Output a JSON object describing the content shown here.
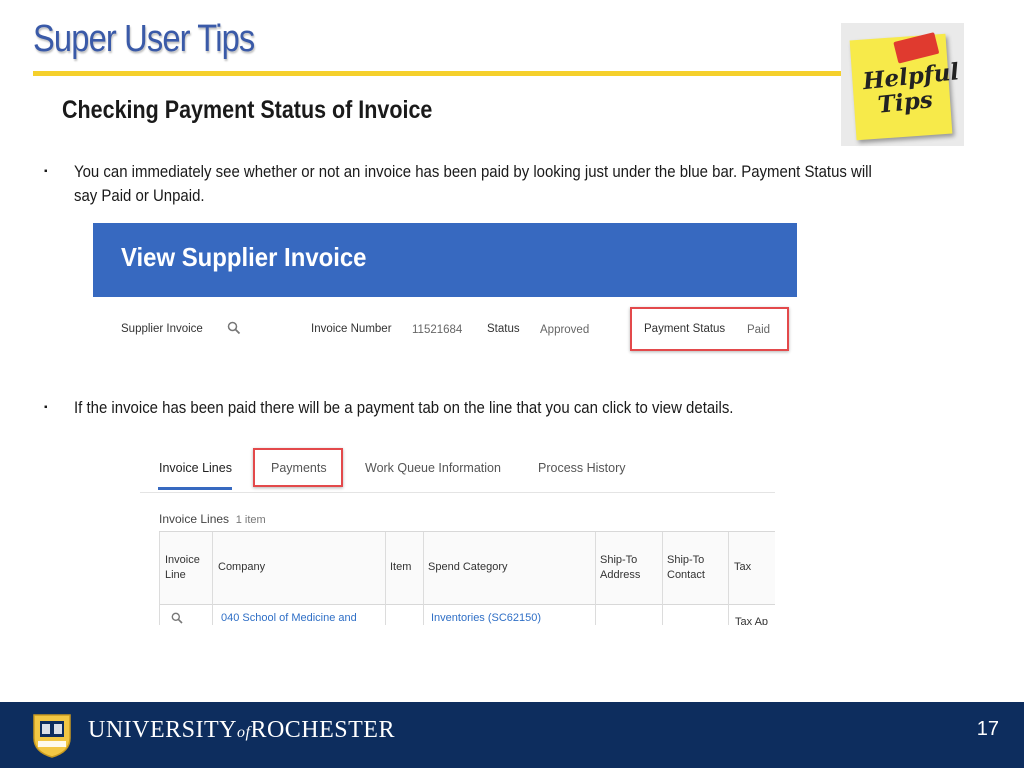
{
  "slide": {
    "title": "Super User Tips",
    "subtitle": "Checking Payment Status of Invoice",
    "bullet_1": "You can immediately see whether or not an invoice has been paid by looking just under the blue bar.  Payment Status will",
    "bullet_1_line2": "say Paid or Unpaid.",
    "bullet_2": "If the invoice has been paid there will be a payment tab on the line that you can click to view details.",
    "bullet_marker": "▪",
    "sticky_note": {
      "line1": "Helpful",
      "line2": "Tips"
    }
  },
  "invoice_header": {
    "title": "View Supplier Invoice",
    "supplier_invoice_label": "Supplier Invoice",
    "invoice_number_label": "Invoice Number",
    "invoice_number_value": "11521684",
    "status_label": "Status",
    "status_value": "Approved",
    "payment_status_label": "Payment Status",
    "payment_status_value": "Paid"
  },
  "invoice_tabs": {
    "tabs": [
      {
        "label": "Invoice Lines",
        "active": true
      },
      {
        "label": "Payments",
        "active": false
      },
      {
        "label": "Work Queue Information",
        "active": false
      },
      {
        "label": "Process History",
        "active": false
      }
    ]
  },
  "invoice_lines": {
    "title": "Invoice Lines",
    "count": "1 item",
    "columns": [
      {
        "line1": "Invoice",
        "line2": "Line"
      },
      {
        "line1": "Company",
        "line2": ""
      },
      {
        "line1": "Item",
        "line2": ""
      },
      {
        "line1": "Spend Category",
        "line2": ""
      },
      {
        "line1": "Ship-To",
        "line2": "Address"
      },
      {
        "line1": "Ship-To",
        "line2": "Contact"
      },
      {
        "line1": "Tax",
        "line2": ""
      }
    ],
    "row": {
      "company": "040 School of Medicine and",
      "spend_category": "Inventories (SC62150)",
      "tax": "Tax Ap"
    }
  },
  "footer": {
    "university_part1": "UNIVERSITY",
    "university_of": "of",
    "university_part2": "ROCHESTER",
    "page_number": "17"
  },
  "colors": {
    "title_blue": "#3a5aa8",
    "rule_yellow": "#f5d02c",
    "bar_blue": "#3769c0",
    "highlight_red": "#e3494b",
    "footer_navy": "#0d2d5e"
  },
  "icons": [
    "search-icon",
    "sticky-note-icon",
    "university-seal-icon"
  ]
}
